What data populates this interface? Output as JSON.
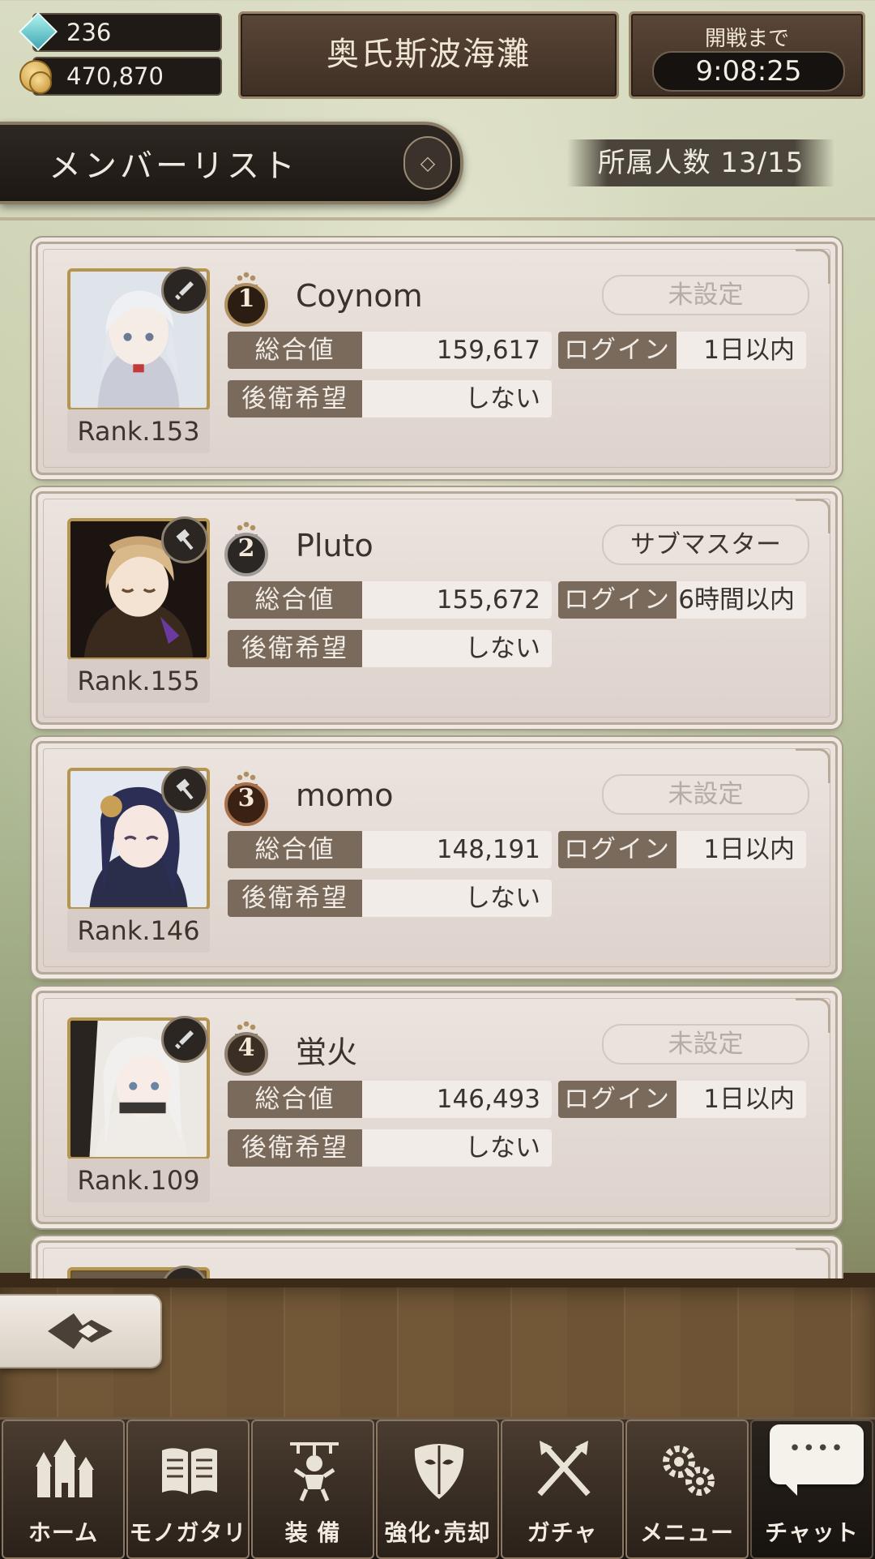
{
  "top_bar": {
    "gems": "236",
    "coins": "470,870",
    "area_title": "奥氏斯波海灘",
    "timer_label": "開戦まで",
    "timer_value": "9:08:25"
  },
  "list_header": {
    "title": "メンバーリスト",
    "member_count": "所属人数 13/15"
  },
  "labels": {
    "total": "総合値",
    "login": "ログイン",
    "rear_guard": "後衛希望"
  },
  "members": [
    {
      "rank_position": "1",
      "medal": "gold",
      "name": "Coynom",
      "role": "未設定",
      "role_set": false,
      "total": "159,617",
      "login": "1日以内",
      "rear_guard": "しない",
      "rank": "Rank.153",
      "weapon": "sword-icon"
    },
    {
      "rank_position": "2",
      "medal": "silver",
      "name": "Pluto",
      "role": "サブマスター",
      "role_set": true,
      "total": "155,672",
      "login": "6時間以内",
      "rear_guard": "しない",
      "rank": "Rank.155",
      "weapon": "hammer-icon"
    },
    {
      "rank_position": "3",
      "medal": "bronze",
      "name": "momo",
      "role": "未設定",
      "role_set": false,
      "total": "148,191",
      "login": "1日以内",
      "rear_guard": "しない",
      "rank": "Rank.146",
      "weapon": "hammer-icon"
    },
    {
      "rank_position": "4",
      "medal": "plain",
      "name": "蛍火",
      "role": "未設定",
      "role_set": false,
      "total": "146,493",
      "login": "1日以内",
      "rear_guard": "しない",
      "rank": "Rank.109",
      "weapon": "sword-icon"
    }
  ],
  "nav": [
    {
      "label": "ホーム",
      "icon": "castle-icon"
    },
    {
      "label": "モノガタリ",
      "icon": "book-icon"
    },
    {
      "label": "装 備",
      "icon": "puppet-icon"
    },
    {
      "label": "強化･売却",
      "icon": "mask-icon"
    },
    {
      "label": "ガチャ",
      "icon": "crossed-swords-icon"
    },
    {
      "label": "メニュー",
      "icon": "gears-icon"
    },
    {
      "label": "チャット",
      "icon": "chat-bubble-icon",
      "bubble": "••••"
    }
  ],
  "colors": {
    "panel_dark": "#3e2f24",
    "card_bg": "#e6ddd7",
    "label_bg": "#7a6a5c",
    "gold": "#b09060"
  }
}
